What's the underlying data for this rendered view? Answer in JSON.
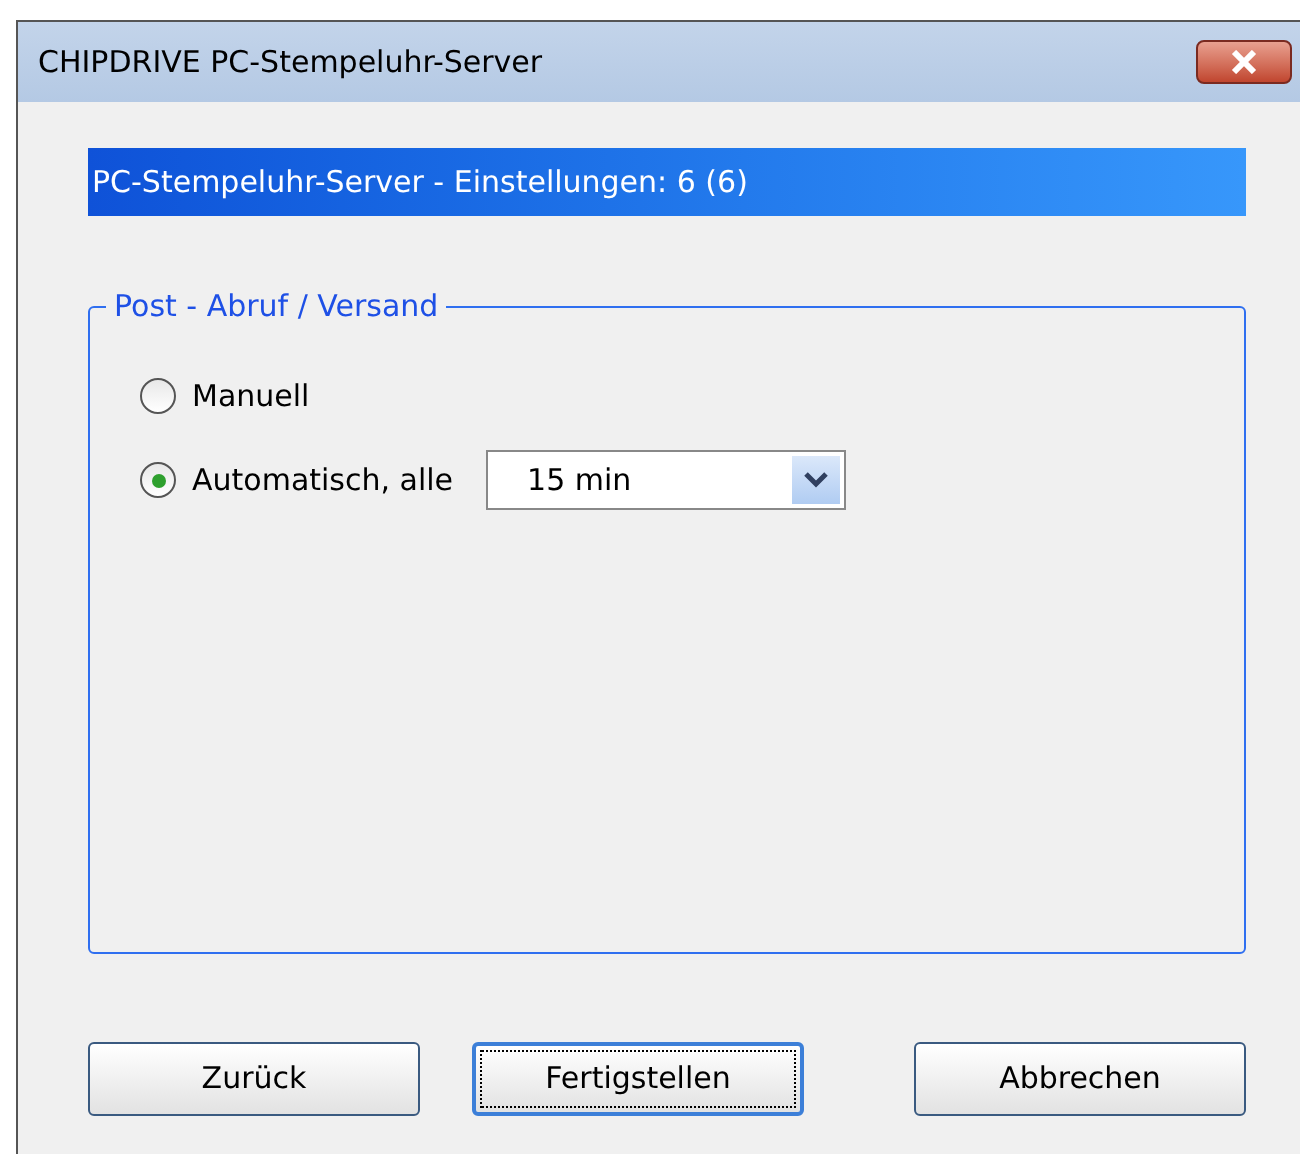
{
  "window": {
    "title": "CHIPDRIVE PC-Stempeluhr-Server"
  },
  "banner": "PC-Stempeluhr-Server - Einstellungen: 6 (6)",
  "group": {
    "title": "Post - Abruf / Versand",
    "options": [
      {
        "label": "Manuell",
        "selected": false
      },
      {
        "label": "Automatisch, alle",
        "selected": true
      }
    ],
    "interval": {
      "value": "15 min"
    }
  },
  "buttons": [
    {
      "label": "Zurück",
      "focused": false
    },
    {
      "label": "Fertigstellen",
      "focused": true
    },
    {
      "label": "Abbrechen",
      "focused": false
    }
  ]
}
